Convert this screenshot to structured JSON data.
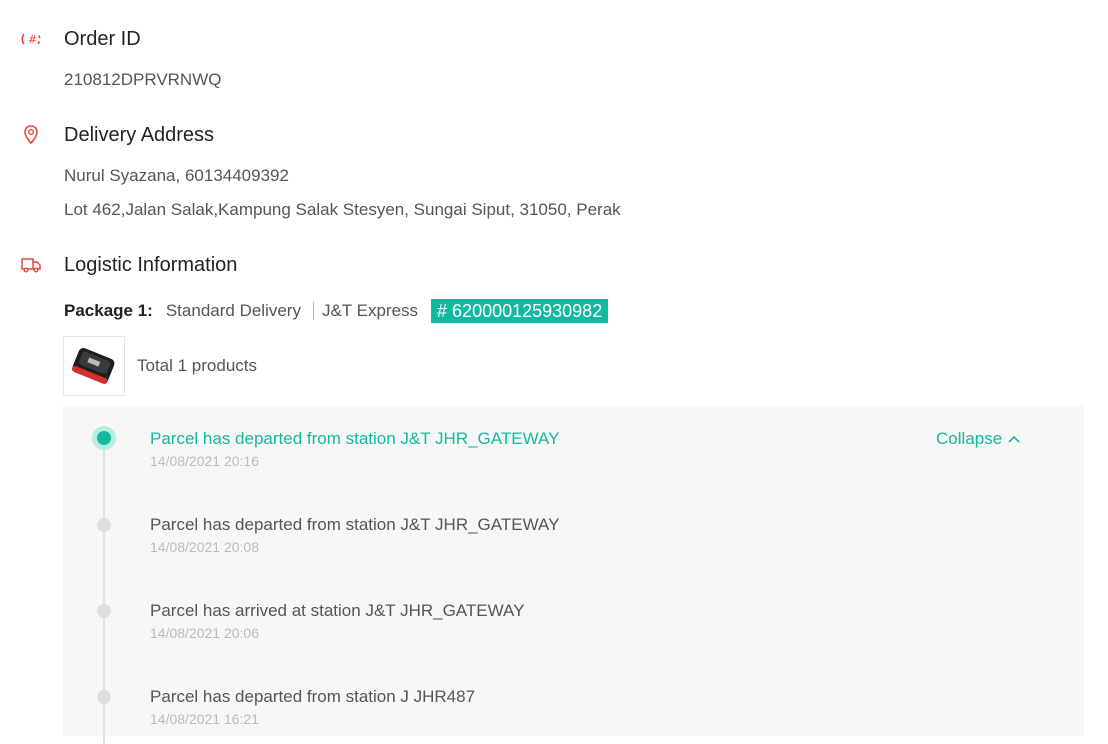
{
  "order": {
    "title": "Order ID",
    "id": "210812DPRVRNWQ"
  },
  "address": {
    "title": "Delivery Address",
    "name_phone": "Nurul Syazana, 60134409392",
    "line": "Lot 462,Jalan Salak,Kampung Salak Stesyen, Sungai Siput, 31050, Perak"
  },
  "logistic": {
    "title": "Logistic Information",
    "package_label": "Package 1:",
    "delivery_type": "Standard Delivery",
    "courier": "J&T Express",
    "tracking": "# 620000125930982",
    "total_products": "Total 1 products",
    "collapse_label": "Collapse"
  },
  "timeline": [
    {
      "title": "Parcel has departed from station J&T JHR_GATEWAY",
      "time": "14/08/2021 20:16"
    },
    {
      "title": "Parcel has departed from station J&T JHR_GATEWAY",
      "time": "14/08/2021 20:08"
    },
    {
      "title": "Parcel has arrived at station J&T JHR_GATEWAY",
      "time": "14/08/2021 20:06"
    },
    {
      "title": "Parcel has departed from station J JHR487",
      "time": "14/08/2021 16:21"
    }
  ],
  "colors": {
    "accent": "#13b99e",
    "icon": "#e8483b"
  },
  "icons": {
    "order": "hash-icon",
    "address": "location-pin-icon",
    "logistic": "truck-icon",
    "collapse": "chevron-up-icon"
  }
}
